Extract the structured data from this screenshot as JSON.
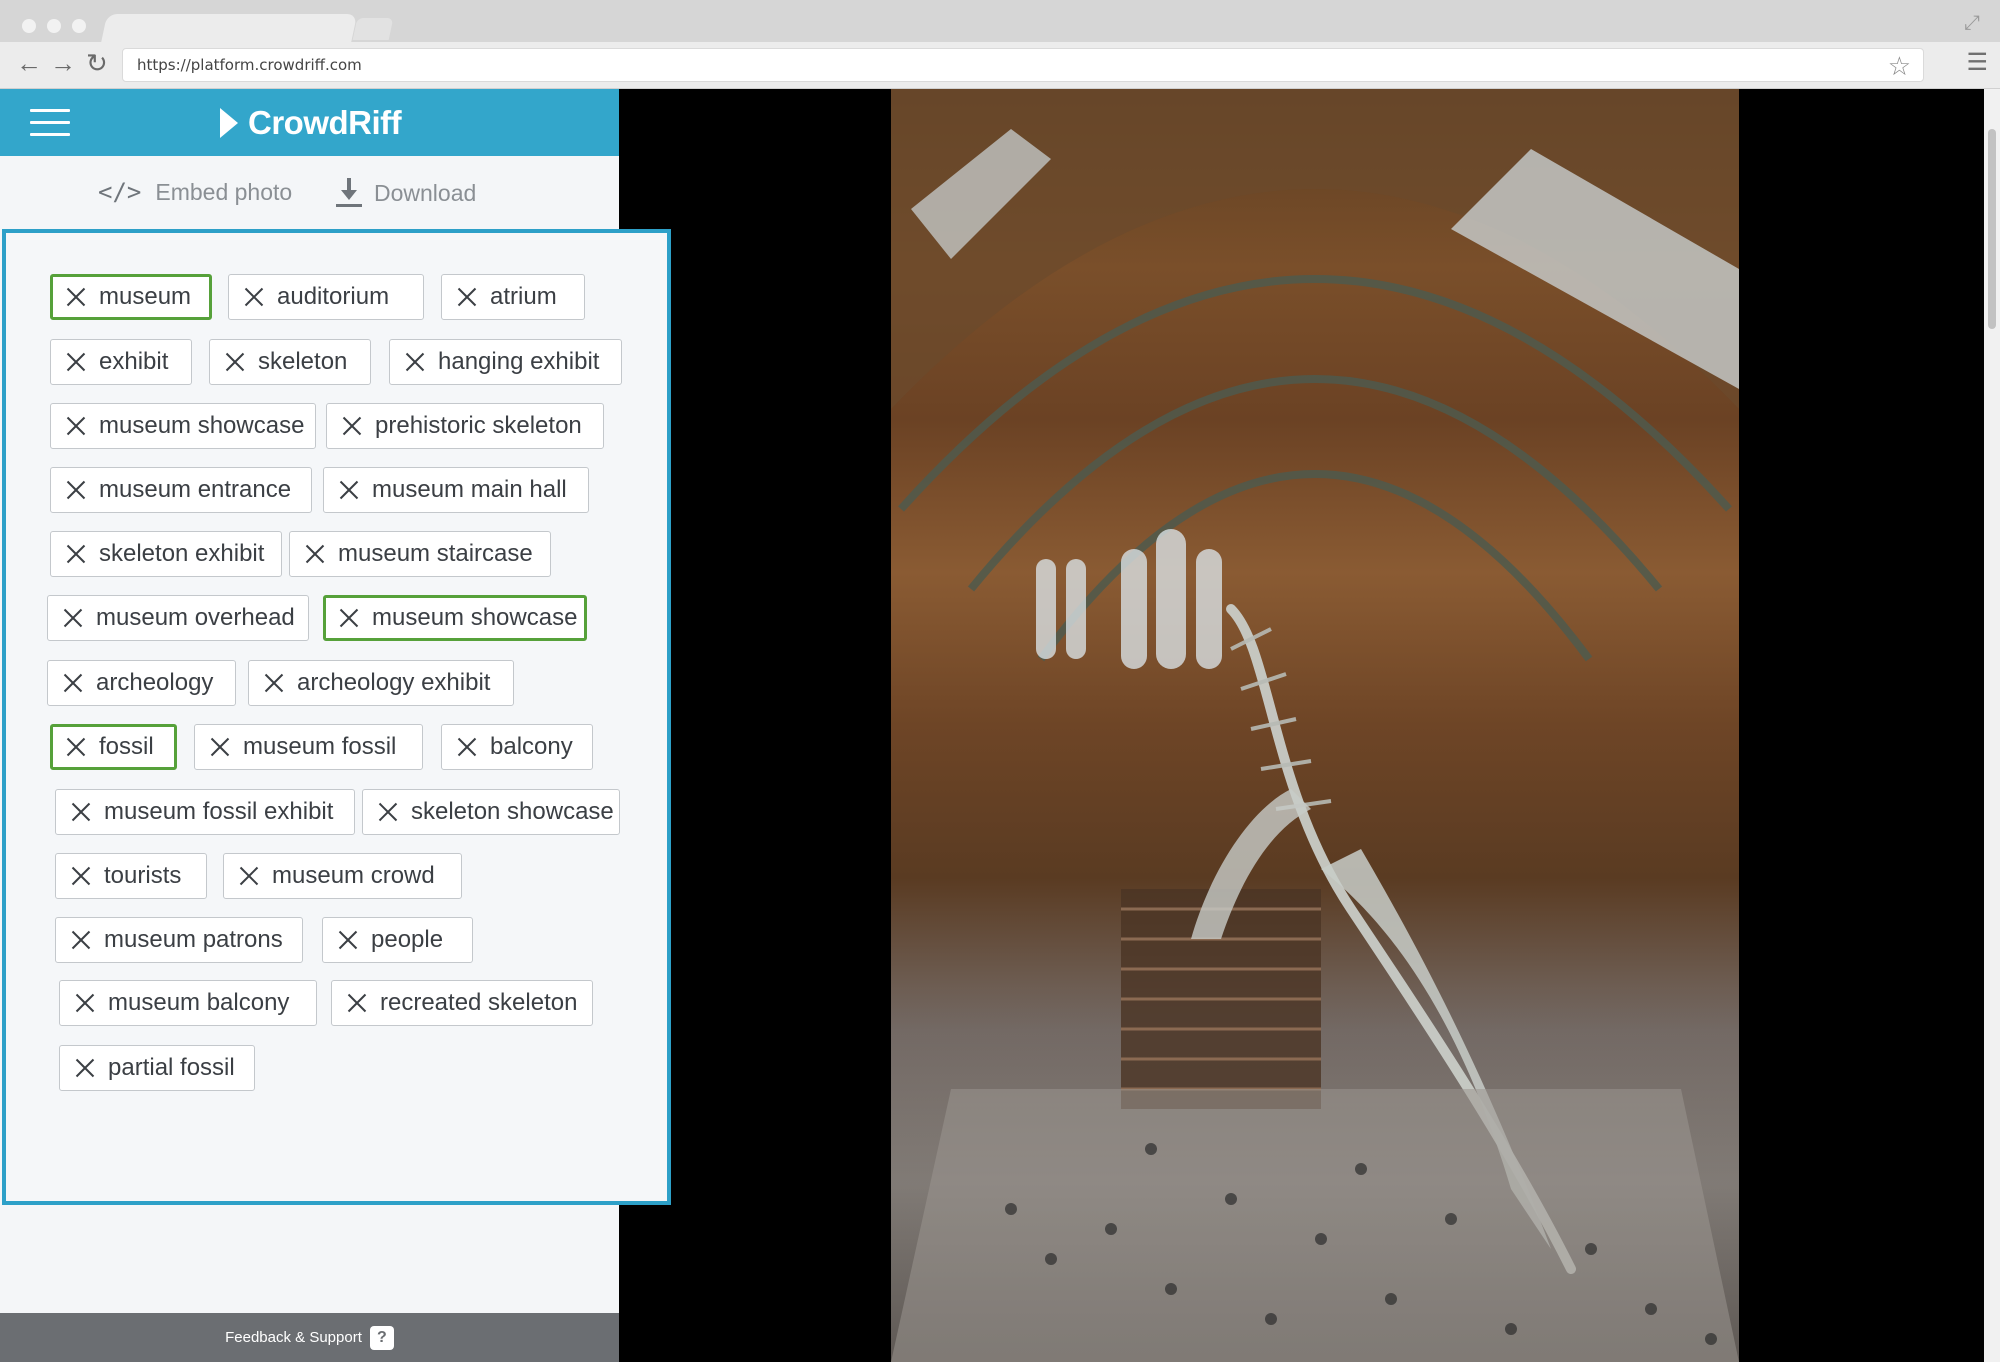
{
  "browser": {
    "url": "https://platform.crowdriff.com",
    "back_icon": "arrow-left-icon",
    "forward_icon": "arrow-right-icon",
    "reload_icon": "reload-icon",
    "bookmark_icon": "star-icon",
    "menu_icon": "menu-icon"
  },
  "header": {
    "brand": "CrowdRiff",
    "color": "#33a6cb"
  },
  "actions": {
    "embed_label": "Embed photo",
    "download_label": "Download"
  },
  "tags": [
    {
      "label": "museum",
      "selected": true
    },
    {
      "label": "auditorium",
      "selected": false
    },
    {
      "label": "atrium",
      "selected": false
    },
    {
      "label": "exhibit",
      "selected": false
    },
    {
      "label": "skeleton",
      "selected": false
    },
    {
      "label": "hanging exhibit",
      "selected": false
    },
    {
      "label": "museum showcase",
      "selected": false
    },
    {
      "label": "prehistoric skeleton",
      "selected": false
    },
    {
      "label": "museum entrance",
      "selected": false
    },
    {
      "label": "museum main hall",
      "selected": false
    },
    {
      "label": "skeleton exhibit",
      "selected": false
    },
    {
      "label": "museum staircase",
      "selected": false
    },
    {
      "label": "museum overhead",
      "selected": false
    },
    {
      "label": "museum showcase",
      "selected": true
    },
    {
      "label": "archeology",
      "selected": false
    },
    {
      "label": "archeology exhibit",
      "selected": false
    },
    {
      "label": "fossil",
      "selected": true
    },
    {
      "label": "museum fossil",
      "selected": false
    },
    {
      "label": "balcony",
      "selected": false
    },
    {
      "label": "museum fossil exhibit",
      "selected": false
    },
    {
      "label": "skeleton showcase",
      "selected": false
    },
    {
      "label": "tourists",
      "selected": false
    },
    {
      "label": "museum crowd",
      "selected": false
    },
    {
      "label": "museum patrons",
      "selected": false
    },
    {
      "label": "people",
      "selected": false
    },
    {
      "label": "museum balcony",
      "selected": false
    },
    {
      "label": "recreated skeleton",
      "selected": false
    },
    {
      "label": "partial fossil",
      "selected": false
    }
  ],
  "colors": {
    "selected_border": "#56a13a",
    "panel_border": "#2da0c8"
  },
  "footer": {
    "label": "Feedback & Support",
    "help": "?"
  }
}
